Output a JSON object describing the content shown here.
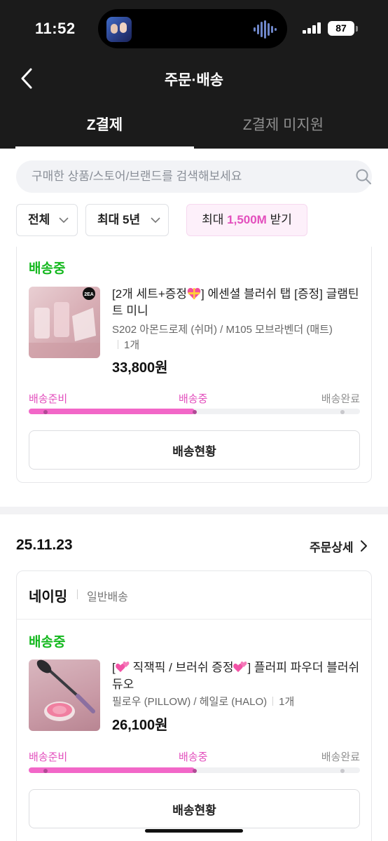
{
  "status_bar": {
    "time": "11:52",
    "battery": "87"
  },
  "header": {
    "title": "주문·배송"
  },
  "tabs": [
    {
      "label": "Z결제"
    },
    {
      "label": "Z결제 미지원"
    }
  ],
  "search": {
    "placeholder": "구매한 상품/스토어/브랜드를 검색해보세요"
  },
  "filters": {
    "all": "전체",
    "period": "최대 5년",
    "promo_prefix": "최대 ",
    "promo_amount": "1,500M",
    "promo_suffix": " 받기"
  },
  "orders": [
    {
      "status": "배송중",
      "product_name_prefix": "[2개 세트+증정",
      "product_name_suffix": "] 에센셜 블러쉬 탭 [증정] 글램틴트 미니",
      "thumb_badge": "2EA",
      "option": "S202 아몬드로제 (쉬머) / M105 모브라벤더 (매트)",
      "qty": "1개",
      "price": "33,800원",
      "stages": [
        "배송준비",
        "배송중",
        "배송완료"
      ],
      "progress": 0.5,
      "button": "배송현황"
    },
    {
      "date": "25.11.23",
      "detail_link": "주문상세",
      "store": "네이밍",
      "shipping_type": "일반배송",
      "status": "배송중",
      "product_name_a": "[",
      "product_name_b": " 직잭픽 / 브러쉬 증정",
      "product_name_c": "] 플러피 파우더 블러쉬 듀오",
      "option": "필로우 (PILLOW) / 헤일로 (HALO)",
      "qty": "1개",
      "price": "26,100원",
      "stages": [
        "배송준비",
        "배송중",
        "배송완료"
      ],
      "progress": 0.5,
      "button": "배송현황"
    }
  ],
  "colors": {
    "accent_pink": "#e34fbd",
    "progress_pink": "#f267c8",
    "status_green": "#14b81e",
    "header_bg": "#1b1b1b"
  },
  "icons": [
    "back-chevron-icon",
    "search-icon",
    "chevron-down-icon",
    "chevron-right-icon",
    "signal-icon",
    "battery-icon",
    "audio-wave-icon",
    "heart-gift-emoji",
    "hearts-emoji"
  ]
}
